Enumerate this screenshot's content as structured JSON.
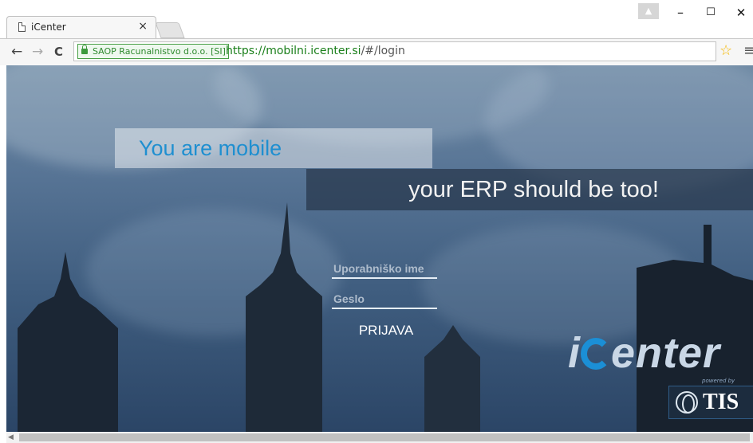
{
  "browser": {
    "tab_title": "iCenter",
    "tab_close": "×",
    "ev_certificate": "SAOP Racunalnistvo d.o.o. [SI]",
    "url_scheme": "https://",
    "url_host": "mobilni.icenter.si",
    "url_path": "/#/login",
    "window_minimize": "–",
    "window_maximize": "☐",
    "window_close": "✕",
    "back": "←",
    "forward": "→",
    "reload": "C",
    "bookmark": "☆",
    "menu": "≡"
  },
  "hero": {
    "tagline_1": "You are mobile",
    "tagline_2": "your ERP should be too!"
  },
  "login": {
    "username_placeholder": "Uporabniško ime",
    "password_placeholder": "Geslo",
    "submit_label": "PRIJAVA"
  },
  "branding": {
    "logo_i": "i",
    "logo_rest": "enter",
    "powered_by": "powered by",
    "partner": "TIS"
  },
  "colors": {
    "accent_blue": "#1f8fd0",
    "secure_green": "#2f8a2f"
  },
  "icons": [
    "page-icon",
    "close-icon",
    "lock-icon",
    "star-icon",
    "menu-icon",
    "globe-icon"
  ]
}
